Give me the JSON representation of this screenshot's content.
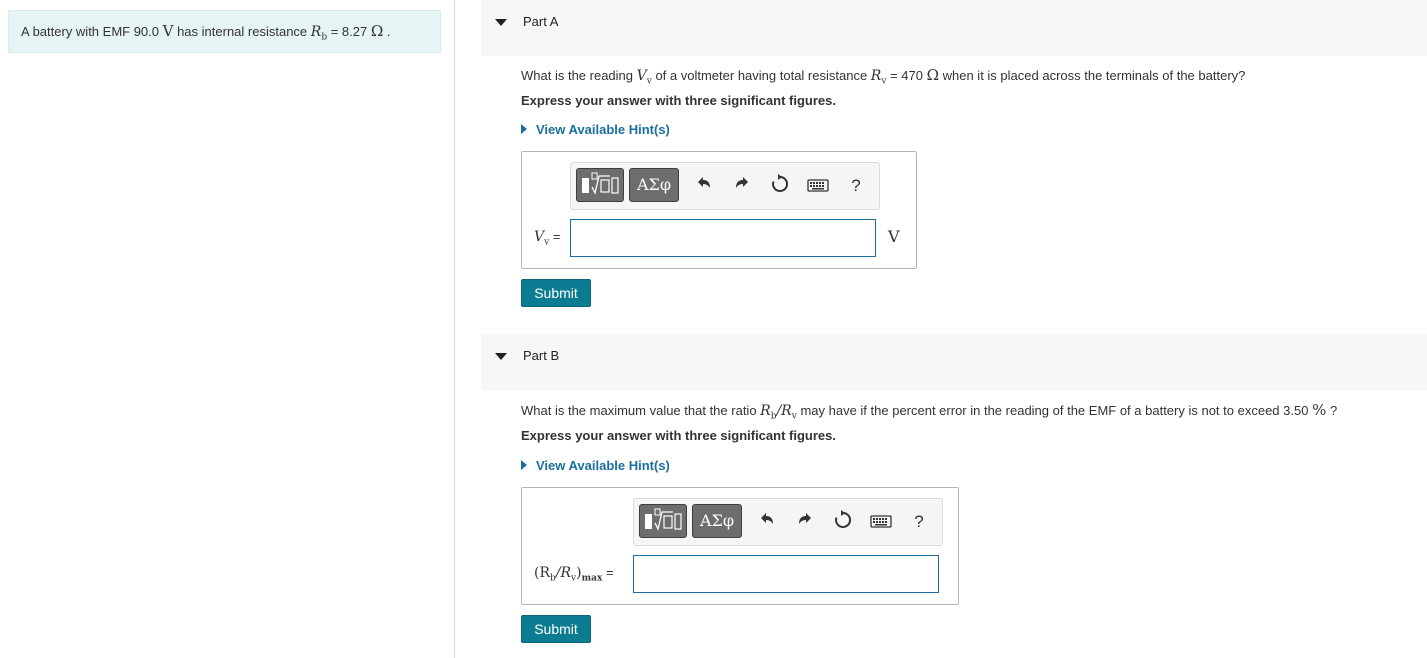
{
  "problem": {
    "intro_pre": "A battery with EMF 90.0 ",
    "intro_v_unit": "V",
    "intro_mid": " has internal resistance ",
    "intro_rb": "R",
    "intro_rb_sub": "b",
    "intro_eq": " = 8.27 ",
    "intro_ohm": "Ω",
    "intro_end": " ."
  },
  "part_a": {
    "title": "Part A",
    "q_pre": "What is the reading ",
    "q_v": "V",
    "q_v_sub": "v",
    "q_mid": " of a voltmeter having total resistance ",
    "q_r": "R",
    "q_r_sub": "v",
    "q_eq": " = 470 ",
    "q_ohm": "Ω",
    "q_end": " when it is placed across the terminals of the battery?",
    "instruction": "Express your answer with three significant figures.",
    "hint": "View Available Hint(s)",
    "answer_label_var": "V",
    "answer_label_sub": "v",
    "answer_label_eq": " =",
    "answer_value": "",
    "unit": "V",
    "submit": "Submit"
  },
  "part_b": {
    "title": "Part B",
    "q_pre": "What is the maximum value that the ratio ",
    "q_ratio": "R",
    "q_ratio_sub1": "b",
    "q_ratio_slash": "/R",
    "q_ratio_sub2": "v",
    "q_end": " may have if the percent error in the reading of the EMF of a battery is not to exceed 3.50 ",
    "q_pct": "%",
    "q_qmark": " ?",
    "instruction": "Express your answer with three significant figures.",
    "hint": "View Available Hint(s)",
    "answer_label_open": "(R",
    "answer_label_sub1": "b",
    "answer_label_mid": "/R",
    "answer_label_sub2": "v",
    "answer_label_close": ")",
    "answer_label_max": "max",
    "answer_label_eq": " =",
    "answer_value": "",
    "submit": "Submit"
  },
  "toolbar": {
    "templates_icon": "templates-icon",
    "greek_label": "ΑΣφ",
    "undo_glyph": "↶",
    "redo_glyph": "↷",
    "reset_glyph": "↻",
    "help_label": "?"
  }
}
